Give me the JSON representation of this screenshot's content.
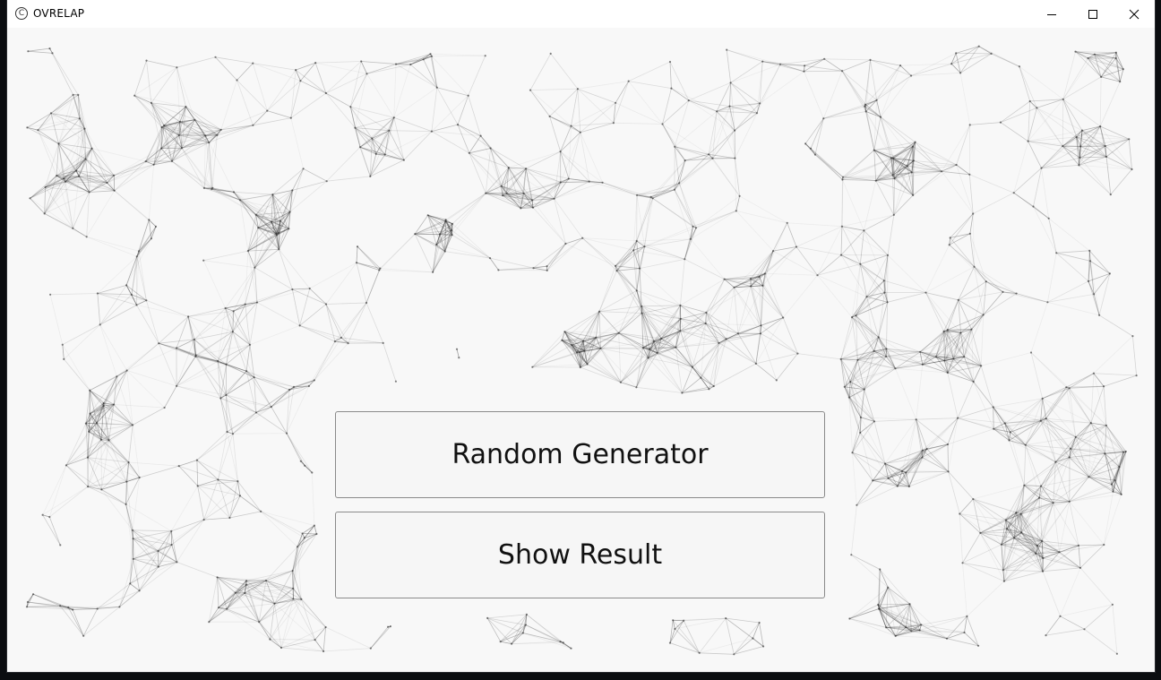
{
  "window": {
    "title": "OVRELAP",
    "app_icon_glyph": "C",
    "controls": {
      "minimize_icon": "minimize-icon",
      "maximize_icon": "maximize-icon",
      "close_icon": "close-icon"
    }
  },
  "buttons": {
    "random_generator_label": "Random Generator",
    "show_result_label": "Show Result"
  },
  "colors": {
    "window_bg": "#f8f8f8",
    "titlebar_bg": "#ffffff",
    "mesh_line": "#3a3a3a",
    "button_bg": "#f6f6f6",
    "button_border": "#8a8a8a"
  }
}
